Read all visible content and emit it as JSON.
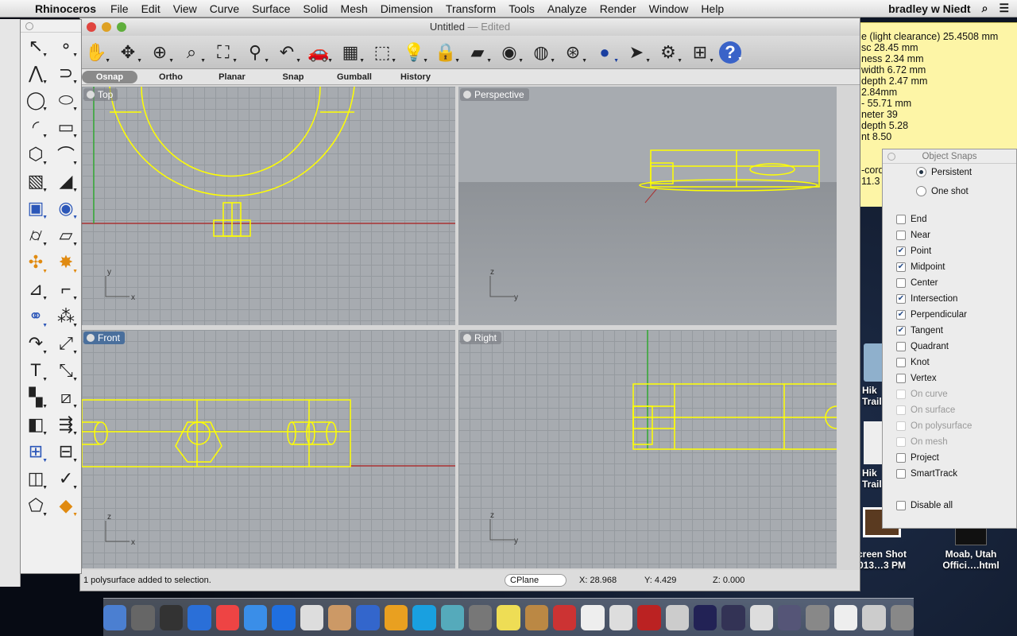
{
  "menubar": {
    "app": "Rhinoceros",
    "items": [
      "File",
      "Edit",
      "View",
      "Curve",
      "Surface",
      "Solid",
      "Mesh",
      "Dimension",
      "Transform",
      "Tools",
      "Analyze",
      "Render",
      "Window",
      "Help"
    ],
    "user": "bradley w Niedt"
  },
  "note": {
    "lines": [
      "e (light clearance) 25.4508 mm",
      "sc 28.45 mm",
      "ness 2.34 mm",
      "width 6.72 mm",
      "depth 2.47 mm",
      " 2.84mm",
      "- 55.71 mm",
      "neter 39",
      "depth 5.28",
      "nt 8.50",
      "",
      "",
      "-cord",
      "11.3"
    ]
  },
  "window": {
    "title": "Untitled",
    "edited": "— Edited"
  },
  "toolbar": {
    "icons": [
      "pan",
      "rotate-view",
      "zoom-in",
      "zoom-window",
      "zoom-extents",
      "zoom-selected",
      "undo-view",
      "car-named-views",
      "cplane",
      "osnap",
      "light",
      "lock",
      "layer",
      "color-wheel",
      "sphere-wire",
      "globe-grid",
      "render-sphere",
      "pointer-render",
      "gear",
      "cplane-layout",
      "help"
    ]
  },
  "tabs": [
    {
      "label": "Osnap",
      "active": true
    },
    {
      "label": "Ortho"
    },
    {
      "label": "Planar"
    },
    {
      "label": "Snap"
    },
    {
      "label": "Gumball"
    },
    {
      "label": "History"
    }
  ],
  "viewports": {
    "top": "Top",
    "perspective": "Perspective",
    "front": "Front",
    "right": "Right"
  },
  "status": {
    "message": "1 polysurface added to selection.",
    "cplane": "CPlane",
    "x": "X: 28.968",
    "y": "Y: 4.429",
    "z": "Z: 0.000"
  },
  "snaps": {
    "title": "Object Snaps",
    "modes": [
      {
        "label": "Persistent",
        "on": true
      },
      {
        "label": "One shot",
        "on": false
      }
    ],
    "items": [
      {
        "label": "End",
        "checked": false
      },
      {
        "label": "Near",
        "checked": false
      },
      {
        "label": "Point",
        "checked": true
      },
      {
        "label": "Midpoint",
        "checked": true
      },
      {
        "label": "Center",
        "checked": false
      },
      {
        "label": "Intersection",
        "checked": true
      },
      {
        "label": "Perpendicular",
        "checked": true
      },
      {
        "label": "Tangent",
        "checked": true
      },
      {
        "label": "Quadrant",
        "checked": false
      },
      {
        "label": "Knot",
        "checked": false
      },
      {
        "label": "Vertex",
        "checked": false
      },
      {
        "label": "On curve",
        "checked": false,
        "disabled": true
      },
      {
        "label": "On surface",
        "checked": false,
        "disabled": true
      },
      {
        "label": "On polysurface",
        "checked": false,
        "disabled": true
      },
      {
        "label": "On mesh",
        "checked": false,
        "disabled": true
      },
      {
        "label": "Project",
        "checked": false
      },
      {
        "label": "SmartTrack",
        "checked": false
      }
    ],
    "disable_all": "Disable all"
  },
  "desktop": [
    {
      "label": "Hik\nTrail"
    },
    {
      "label": "Hik\nTrail"
    },
    {
      "label": "creen Shot\n013…3 PM"
    },
    {
      "label": "Moab, Utah\nOffici….html"
    }
  ],
  "colors": {
    "wire": "#ffff00",
    "note": "#fdf5a6",
    "active_label": "#4a6f9c"
  }
}
